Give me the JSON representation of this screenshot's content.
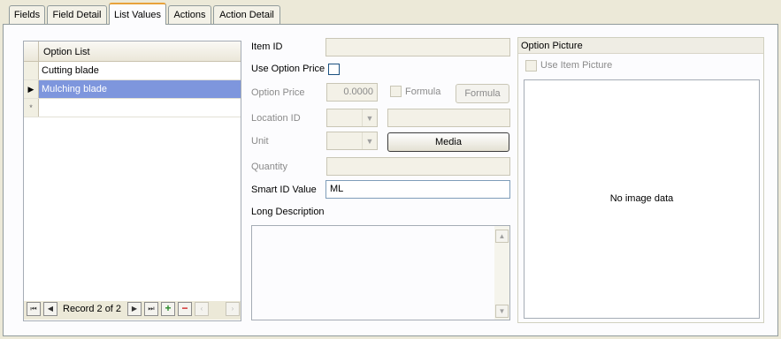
{
  "tabs": [
    {
      "label": "Fields",
      "active": false
    },
    {
      "label": "Field Detail",
      "active": false
    },
    {
      "label": "List Values",
      "active": true
    },
    {
      "label": "Actions",
      "active": false
    },
    {
      "label": "Action Detail",
      "active": false
    }
  ],
  "option_list": {
    "column_header": "Option List",
    "rows": [
      "Cutting blade",
      "Mulching blade"
    ],
    "selected_index": 1,
    "new_row_marker": "*",
    "current_row_marker": "▶"
  },
  "navigator": {
    "record_text": "Record 2 of 2",
    "first_icon": "⏮",
    "prev_icon": "◀",
    "next_icon": "▶",
    "last_icon": "⏭",
    "add_icon": "+",
    "delete_icon": "−",
    "scroll_left_icon": "‹",
    "scroll_right_icon": "›"
  },
  "form": {
    "item_id_label": "Item ID",
    "item_id_value": "",
    "use_option_price_label": "Use Option Price",
    "use_option_price_checked": false,
    "option_price_label": "Option Price",
    "option_price_value": "0.0000",
    "formula_checkbox_label": "Formula",
    "formula_button_label": "Formula",
    "location_id_label": "Location ID",
    "location_id_value": "",
    "unit_label": "Unit",
    "media_button_label": "Media",
    "quantity_label": "Quantity",
    "quantity_value": "",
    "smart_id_label": "Smart ID Value",
    "smart_id_value": "ML",
    "long_description_label": "Long Description",
    "long_description_value": ""
  },
  "picture": {
    "group_title": "Option Picture",
    "use_item_picture_label": "Use Item Picture",
    "no_image_text": "No image data"
  }
}
